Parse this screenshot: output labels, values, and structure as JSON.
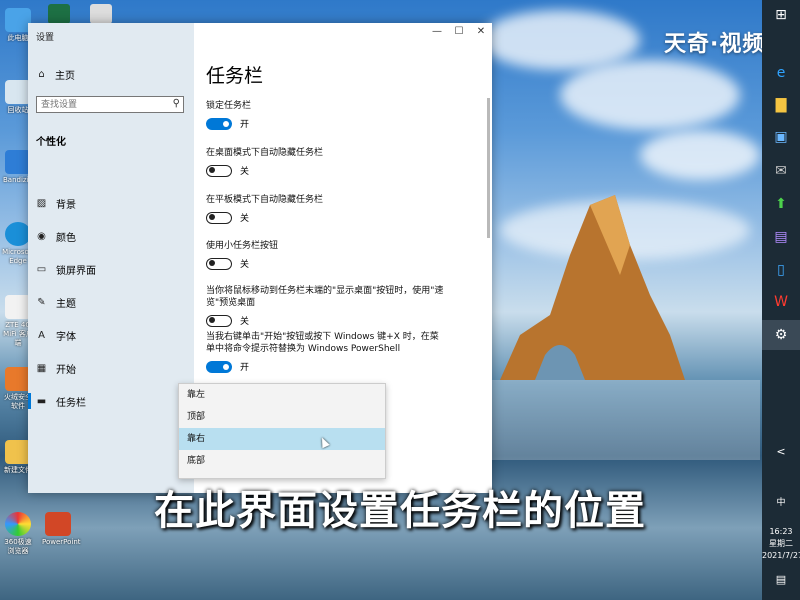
{
  "desktop": {
    "icons": [
      {
        "label": "此电脑"
      },
      {
        "label": "回收站"
      },
      {
        "label": "Bandizip"
      },
      {
        "label": "Microsoft Edge"
      },
      {
        "label": "ZTE 4G MiFi 客户端"
      },
      {
        "label": "火绒安全软件"
      },
      {
        "label": "新建文件"
      },
      {
        "label": "360极速浏览器"
      },
      {
        "label": "PowerPoint"
      }
    ],
    "watermark": "天奇·视频",
    "subtitle": "在此界面设置任务栏的位置"
  },
  "taskbar": {
    "icons": [
      "windows-logo-icon",
      "edge-icon",
      "file-explorer-icon",
      "store-icon",
      "mail-icon",
      "upload-icon",
      "premiere-icon",
      "phone-icon",
      "wps-icon",
      "settings-gear-icon"
    ],
    "tray": {
      "chevron": "<",
      "ime": "中",
      "time": "16:23",
      "weekday": "星期二",
      "date": "2021/7/27"
    }
  },
  "window": {
    "title": "设置",
    "controls": {
      "minimize": "—",
      "maximize": "☐",
      "close": "✕"
    },
    "sidebar": {
      "home": "主页",
      "search_placeholder": "查找设置",
      "section": "个性化",
      "items": [
        {
          "label": "背景",
          "icon": "picture-icon"
        },
        {
          "label": "颜色",
          "icon": "palette-icon"
        },
        {
          "label": "锁屏界面",
          "icon": "lockscreen-icon"
        },
        {
          "label": "主题",
          "icon": "brush-icon"
        },
        {
          "label": "字体",
          "icon": "font-icon"
        },
        {
          "label": "开始",
          "icon": "start-icon"
        },
        {
          "label": "任务栏",
          "icon": "taskbar-icon",
          "selected": true
        }
      ]
    },
    "main": {
      "title": "任务栏",
      "settings": [
        {
          "label": "锁定任务栏",
          "state": "开",
          "on": true
        },
        {
          "label": "在桌面模式下自动隐藏任务栏",
          "state": "关",
          "on": false
        },
        {
          "label": "在平板模式下自动隐藏任务栏",
          "state": "关",
          "on": false
        },
        {
          "label": "使用小任务栏按钮",
          "state": "关",
          "on": false
        },
        {
          "label": "当你将鼠标移动到任务栏末端的\"显示桌面\"按钮时，使用\"速览\"预览桌面",
          "state": "关",
          "on": false
        },
        {
          "label": "当我右键单击\"开始\"按钮或按下 Windows 键+X 时，在菜单中将命令提示符替换为 Windows PowerShell",
          "state": "开",
          "on": true
        }
      ],
      "position_dropdown": {
        "options": [
          "靠左",
          "顶部",
          "靠右",
          "底部"
        ],
        "highlighted": "靠右"
      }
    }
  },
  "colors": {
    "accent": "#0078d7",
    "taskbar": "#1c2b36"
  }
}
